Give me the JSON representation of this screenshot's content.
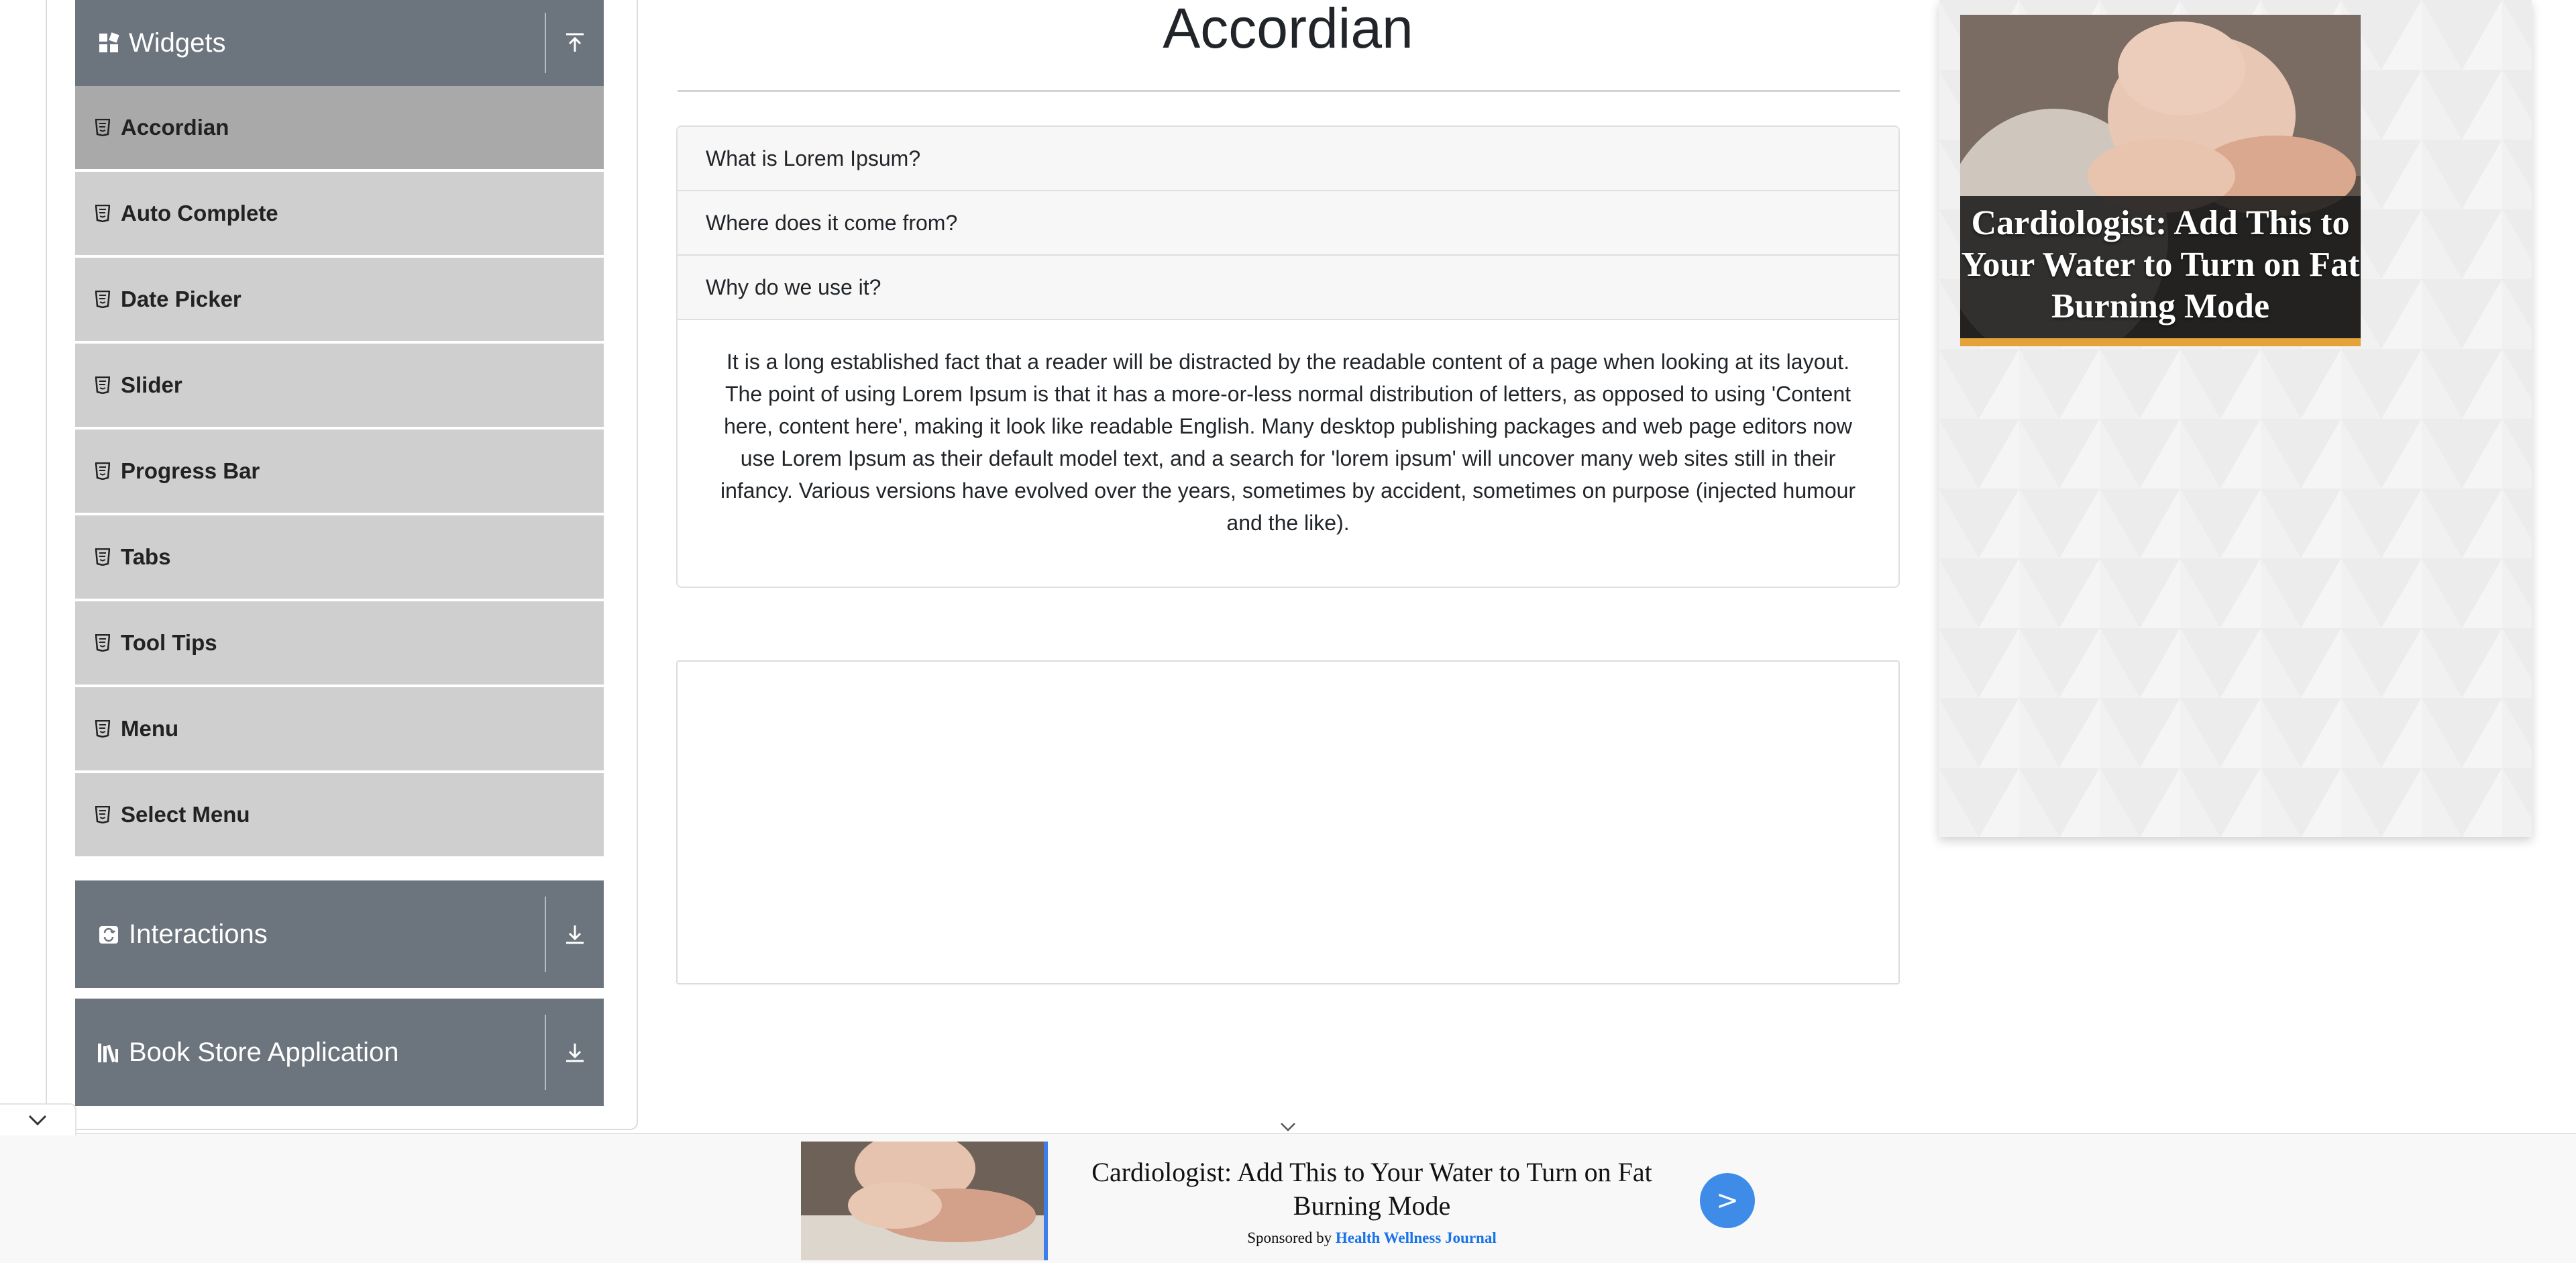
{
  "sidebar": {
    "widgets": {
      "title": "Widgets"
    },
    "items": [
      {
        "label": "Accordian"
      },
      {
        "label": "Auto Complete"
      },
      {
        "label": "Date Picker"
      },
      {
        "label": "Slider"
      },
      {
        "label": "Progress Bar"
      },
      {
        "label": "Tabs"
      },
      {
        "label": "Tool Tips"
      },
      {
        "label": "Menu"
      },
      {
        "label": "Select Menu"
      }
    ],
    "interactions": {
      "title": "Interactions"
    },
    "bookstore": {
      "title": "Book Store Application"
    }
  },
  "main": {
    "title": "Accordian",
    "sections": [
      {
        "header": "What is Lorem Ipsum?"
      },
      {
        "header": "Where does it come from?"
      },
      {
        "header": "Why do we use it?",
        "body": "It is a long established fact that a reader will be distracted by the readable content of a page when looking at its layout. The point of using Lorem Ipsum is that it has a more-or-less normal distribution of letters, as opposed to using 'Content here, content here', making it look like readable English. Many desktop publishing packages and web page editors now use Lorem Ipsum as their default model text, and a search for 'lorem ipsum' will uncover many web sites still in their infancy. Various versions have evolved over the years, sometimes by accident, sometimes on purpose (injected humour and the like)."
      }
    ]
  },
  "right_ad": {
    "headline": "Cardiologist: Add This to Your Water to Turn on Fat Burning Mode"
  },
  "bottom_ad": {
    "headline": "Cardiologist: Add This to Your Water to Turn on Fat Burning Mode",
    "sponsored_prefix": "Sponsored by",
    "sponsor": "Health Wellness Journal",
    "button_label": ">"
  },
  "colors": {
    "group_header": "#6c757d",
    "menu_item": "#cfcfcf",
    "menu_item_active": "#a9a9a9",
    "ad_accent": "#3f7ee8",
    "ad_bar": "#e5a23a"
  }
}
